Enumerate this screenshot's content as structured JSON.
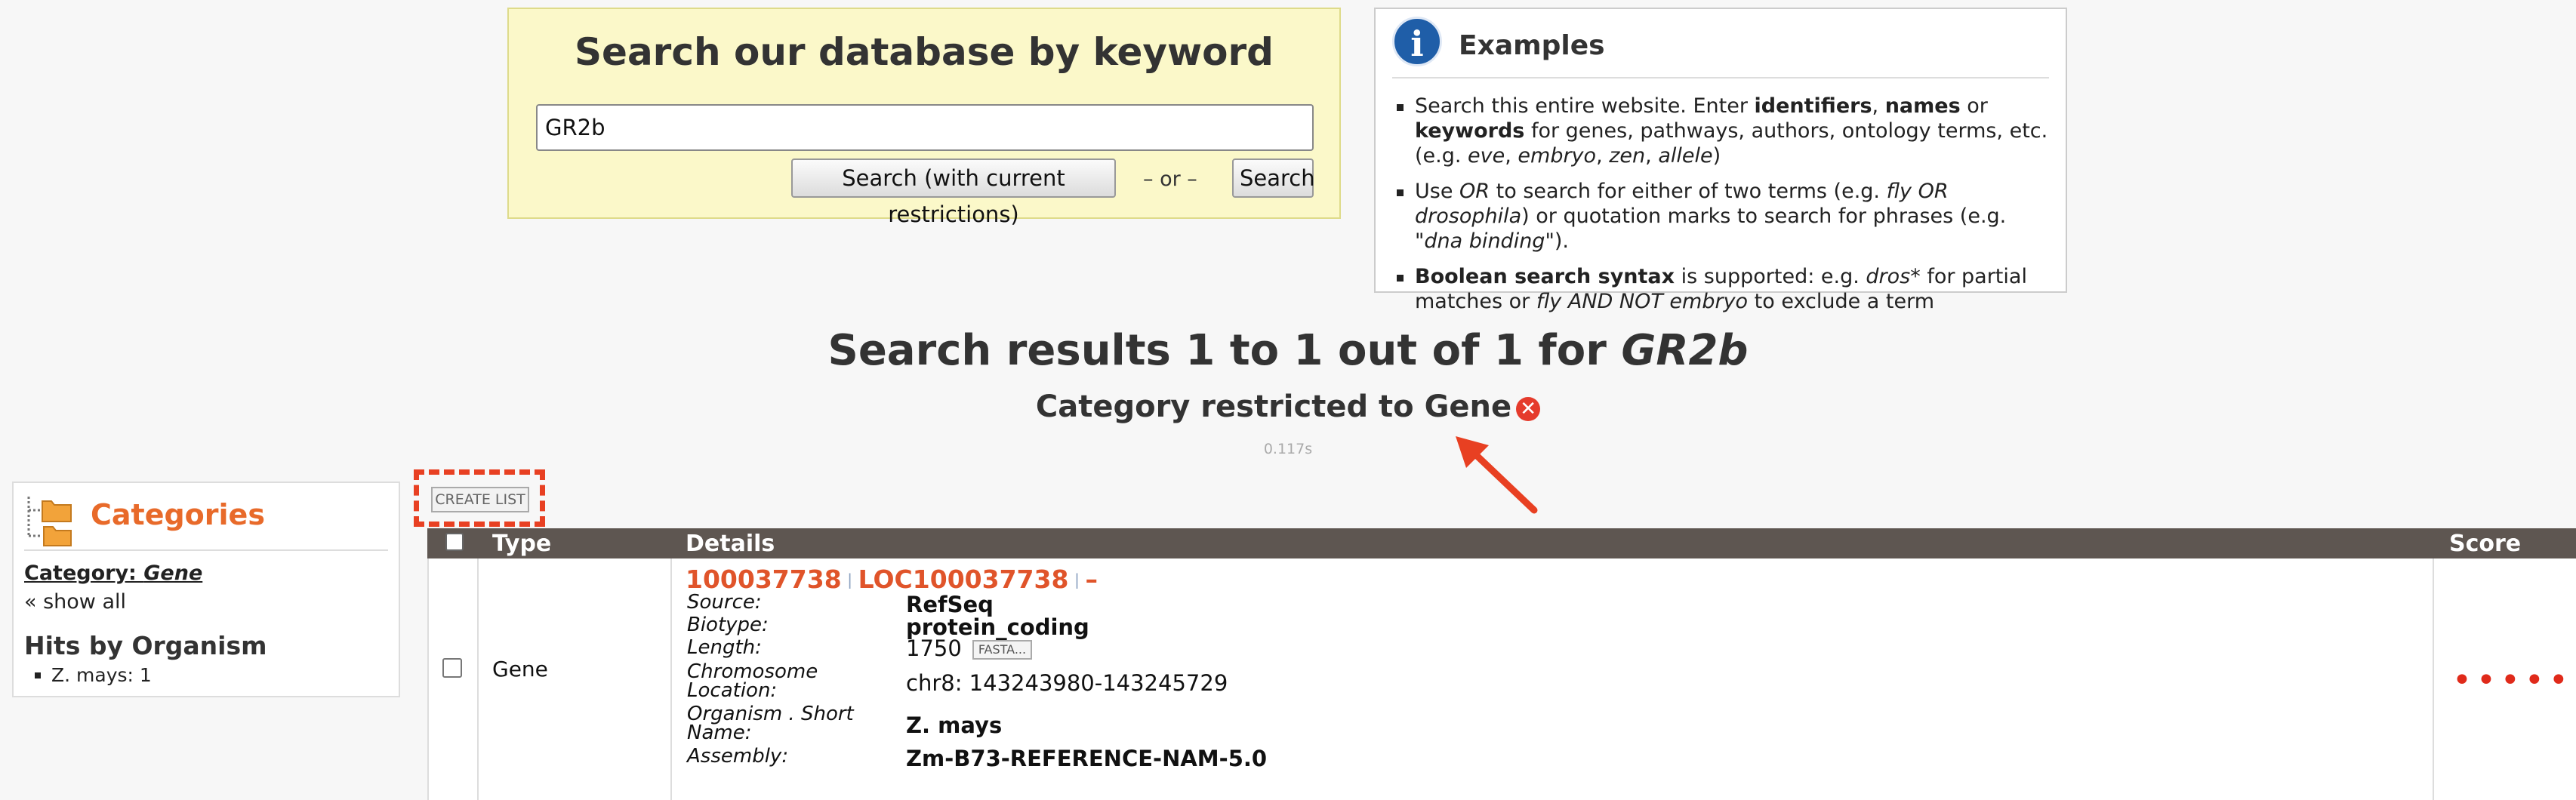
{
  "search": {
    "title": "Search our database by keyword",
    "query": "GR2b",
    "restrict_button": "Search (with current restrictions)",
    "or_text": "– or –",
    "search_button": "Search"
  },
  "examples": {
    "title": "Examples",
    "items": [
      [
        "Search this entire website. Enter ",
        {
          "b": "identifiers"
        },
        ", ",
        {
          "b": "names"
        },
        " or ",
        {
          "b": "keywords"
        },
        " for genes, pathways, authors, ontology terms, etc. (e.g. ",
        {
          "i": "eve"
        },
        ", ",
        {
          "i": "embryo"
        },
        ", ",
        {
          "i": "zen"
        },
        ", ",
        {
          "i": "allele"
        },
        ")"
      ],
      [
        "Use ",
        {
          "i": "OR"
        },
        " to search for either of two terms (e.g. ",
        {
          "i": "fly OR drosophila"
        },
        ") or quotation marks to search for phrases (e.g. ",
        {
          "i": "\"dna binding\""
        },
        ")."
      ],
      [
        {
          "b": "Boolean search syntax"
        },
        " is supported: e.g. ",
        {
          "i": "dros*"
        },
        " for partial matches or ",
        {
          "i": "fly AND NOT embryo"
        },
        " to exclude a term"
      ]
    ]
  },
  "results": {
    "heading_prefix": "Search results 1 to 1 out of 1 for ",
    "query": "GR2b",
    "category_line": "Category restricted to Gene",
    "remove_icon": "✕",
    "timing": "0.117s"
  },
  "categories": {
    "title": "Categories",
    "current_prefix": "Category: ",
    "current_value": "Gene",
    "show_all": "« show all",
    "hits_title": "Hits by Organism",
    "hits": [
      "Z. mays: 1"
    ]
  },
  "create_list_label": "CREATE LIST",
  "table": {
    "headers": {
      "type": "Type",
      "details": "Details",
      "score": "Score"
    },
    "row": {
      "type": "Gene",
      "id1": "100037738",
      "id2": "LOC100037738",
      "id3": "–",
      "separator": "|",
      "fields": [
        {
          "label": "Source:",
          "value": "RefSeq",
          "bold": true
        },
        {
          "label": "Biotype:",
          "value": "protein_coding",
          "bold": true
        },
        {
          "label": "Length:",
          "value": "1750",
          "bold": false,
          "fasta": "FASTA..."
        },
        {
          "label": "Chromosome Location:",
          "value": "chr8: 143243980-143245729",
          "bold": false
        },
        {
          "label": "Organism . Short Name:",
          "value": "Z. mays",
          "bold": true
        },
        {
          "label": "Assembly:",
          "value": "Zm-B73-REFERENCE-NAM-5.0",
          "bold": true
        }
      ],
      "score": "•••••"
    }
  },
  "colors": {
    "accent": "#e86a2a",
    "annotation_red": "#e84022",
    "table_header": "#5e5651",
    "search_box_bg": "#fbf8c9"
  }
}
